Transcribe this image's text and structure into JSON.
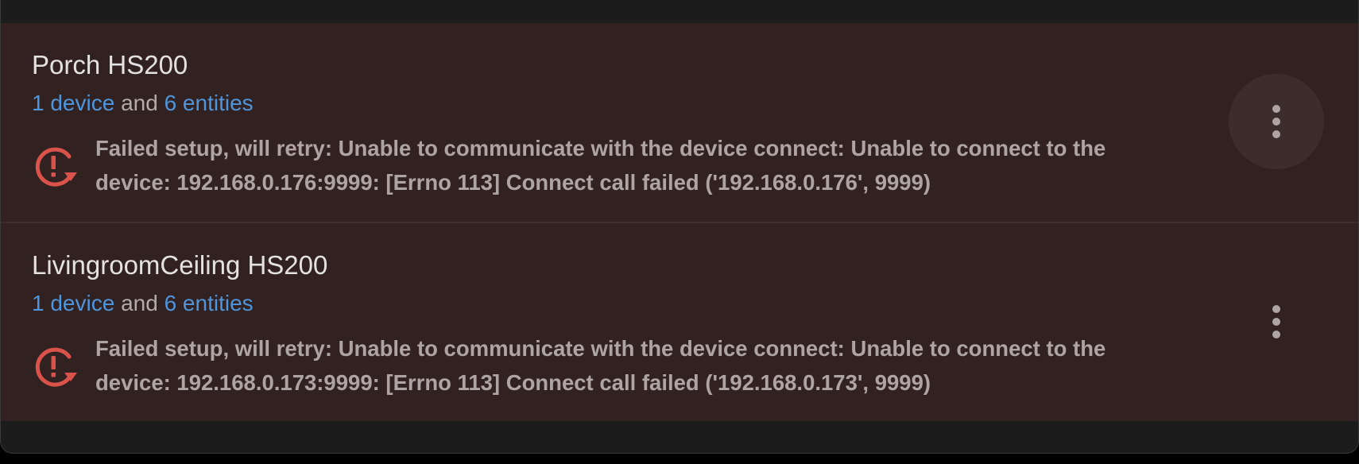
{
  "entries": [
    {
      "title": "Porch HS200",
      "devices_link": "1 device",
      "and_text": "and",
      "entities_link": "6 entities",
      "message": "Failed setup, will retry: Unable to communicate with the device connect: Unable to connect to the device: 192.168.0.176:9999: [Errno 113] Connect call failed ('192.168.0.176', 9999)",
      "status_icon": "retry-error-icon",
      "menu_icon": "dots-vertical-icon"
    },
    {
      "title": "LivingroomCeiling HS200",
      "devices_link": "1 device",
      "and_text": "and",
      "entities_link": "6 entities",
      "message": "Failed setup, will retry: Unable to communicate with the device connect: Unable to connect to the device: 192.168.0.173:9999: [Errno 113] Connect call failed ('192.168.0.173', 9999)",
      "status_icon": "retry-error-icon",
      "menu_icon": "dots-vertical-icon"
    }
  ],
  "colors": {
    "entry_background": "#312120",
    "card_background": "#1c1c1c",
    "link": "#4f95dc",
    "error_icon": "#d9534a",
    "title_text": "#e4e2e1",
    "message_text": "#aea4a3"
  }
}
